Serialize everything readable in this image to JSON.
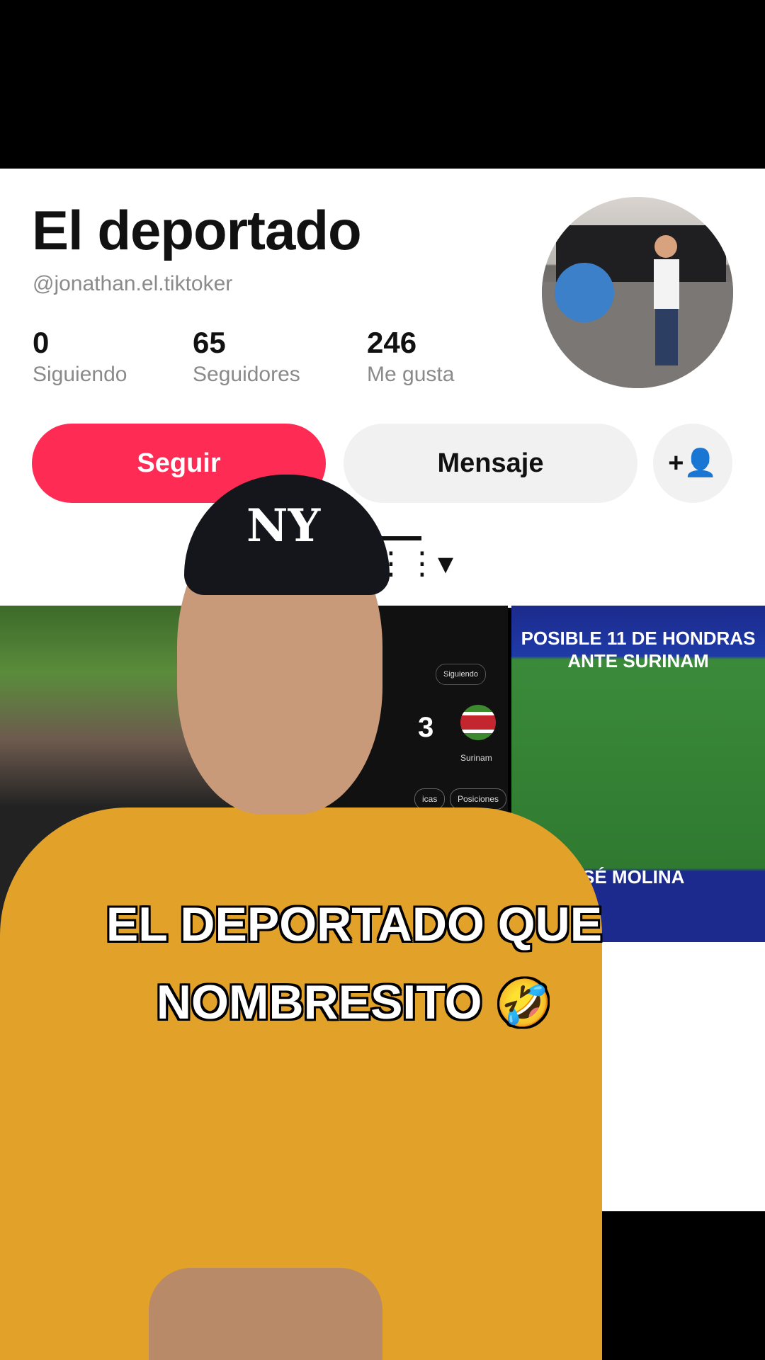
{
  "profile": {
    "name": "El deportado",
    "handle": "@jonathan.el.tiktoker",
    "stats": [
      {
        "value": "0",
        "label": "Siguiendo"
      },
      {
        "value": "65",
        "label": "Seguidores"
      },
      {
        "value": "246",
        "label": "Me gusta"
      }
    ],
    "buttons": {
      "follow": "Seguir",
      "message": "Mensaje",
      "add_friend_icon": "+👤"
    }
  },
  "tabs": {
    "grid_icon": "⋮⋮▾"
  },
  "thumbnails": {
    "second": {
      "score": "3",
      "country": "Surinam",
      "following_pill": "Siguiendo",
      "tab1": "icas",
      "tab2": "Posiciones"
    },
    "third": {
      "title": "POSIBLE 11 DE HONDRAS ANTE SURINAM",
      "name": "SÉ MOLINA"
    }
  },
  "overlay": {
    "cap_logo": "NY",
    "caption_line1": "EL DEPORTADO QUE",
    "caption_line2": "NOMBRESITO",
    "caption_emoji": "🤣"
  },
  "colors": {
    "brand": "#fe2c55",
    "secondary_button": "#f1f1f2",
    "shirt": "#e2a128"
  }
}
